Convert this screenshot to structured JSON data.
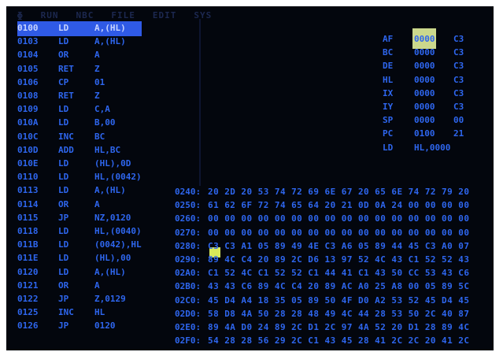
{
  "menu": [
    "ɸ",
    "RUN",
    "NBC",
    "FILE",
    "EDIT",
    "SYS"
  ],
  "disassembly": [
    {
      "addr": "0100",
      "op": "LD",
      "arg": "A,(HL)",
      "selected": true
    },
    {
      "addr": "0103",
      "op": "LD",
      "arg": "A,(HL)"
    },
    {
      "addr": "0104",
      "op": "OR",
      "arg": "A"
    },
    {
      "addr": "0105",
      "op": "RET",
      "arg": "Z"
    },
    {
      "addr": "0106",
      "op": "CP",
      "arg": "01"
    },
    {
      "addr": "0108",
      "op": "RET",
      "arg": "Z"
    },
    {
      "addr": "0109",
      "op": "LD",
      "arg": "C,A"
    },
    {
      "addr": "010A",
      "op": "LD",
      "arg": "B,00"
    },
    {
      "addr": "010C",
      "op": "INC",
      "arg": "BC"
    },
    {
      "addr": "010D",
      "op": "ADD",
      "arg": "HL,BC"
    },
    {
      "addr": "010E",
      "op": "LD",
      "arg": "(HL),0D"
    },
    {
      "addr": "0110",
      "op": "LD",
      "arg": "HL,(0042)"
    },
    {
      "addr": "0113",
      "op": "LD",
      "arg": "A,(HL)"
    },
    {
      "addr": "0114",
      "op": "OR",
      "arg": "A"
    },
    {
      "addr": "0115",
      "op": "JP",
      "arg": "NZ,0120"
    },
    {
      "addr": "0118",
      "op": "LD",
      "arg": "HL,(0040)"
    },
    {
      "addr": "011B",
      "op": "LD",
      "arg": "(0042),HL"
    },
    {
      "addr": "011E",
      "op": "LD",
      "arg": "(HL),00"
    },
    {
      "addr": "0120",
      "op": "LD",
      "arg": "A,(HL)"
    },
    {
      "addr": "0121",
      "op": "OR",
      "arg": "A"
    },
    {
      "addr": "0122",
      "op": "JP",
      "arg": "Z,0129"
    },
    {
      "addr": "0125",
      "op": "INC",
      "arg": "HL"
    },
    {
      "addr": "0126",
      "op": "JP",
      "arg": "0120"
    }
  ],
  "registers": [
    {
      "name": "AF",
      "value": "0000",
      "extra": "C3"
    },
    {
      "name": "BC",
      "value": "0000",
      "extra": "C3"
    },
    {
      "name": "DE",
      "value": "0000",
      "extra": "C3"
    },
    {
      "name": "HL",
      "value": "0000",
      "extra": "C3"
    },
    {
      "name": "IX",
      "value": "0000",
      "extra": "C3"
    },
    {
      "name": "IY",
      "value": "0000",
      "extra": "C3"
    },
    {
      "name": "SP",
      "value": "0000",
      "extra": "00"
    },
    {
      "name": "PC",
      "value": "0100",
      "extra": "21"
    },
    {
      "name": "LD",
      "value": "HL,0000",
      "extra": ""
    }
  ],
  "memory": [
    {
      "addr": "0240:",
      "bytes": "20 2D 20 53 74 72 69 6E 67 20 65 6E 74 72 79 20"
    },
    {
      "addr": "0250:",
      "bytes": "61 62 6F 72 74 65 64 20 21 0D 0A 24 00 00 00 00"
    },
    {
      "addr": "0260:",
      "bytes": "00 00 00 00 00 00 00 00 00 00 00 00 00 00 00 00"
    },
    {
      "addr": "0270:",
      "bytes": "00 00 00 00 00 00 00 00 00 00 00 00 00 00 00 00"
    },
    {
      "addr": "0280:",
      "bytes": "C3 C3 A1 05 89 49 4E C3 A6 05 89 44 45 C3 A0 07"
    },
    {
      "addr": "0290:",
      "bytes": "89 4C C4 20 89 2C D6 13 97 52 4C 43 C1 52 52 43"
    },
    {
      "addr": "02A0:",
      "bytes": "C1 52 4C C1 52 52 C1 44 41 C1 43 50 CC 53 43 C6"
    },
    {
      "addr": "02B0:",
      "bytes": "43 43 C6 89 4C C4 20 89 AC A0 25 A8 00 05 89 5C"
    },
    {
      "addr": "02C0:",
      "bytes": "45 D4 A4 18 35 05 89 50 4F D0 A2 53 52 45 D4 45"
    },
    {
      "addr": "02D0:",
      "bytes": "58 D8 4A 50 28 28 48 49 4C 44 28 53 50 2C 40 87"
    },
    {
      "addr": "02E0:",
      "bytes": "89 4A D0 24 89 2C D1 2C 97 4A 52 20 D1 28 89 4C"
    },
    {
      "addr": "02F0:",
      "bytes": "54 28 28 56 29 2C C1 43 45 28 41 2C 2C 20 41 2C"
    }
  ]
}
